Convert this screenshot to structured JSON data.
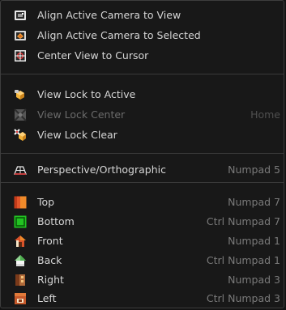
{
  "menu": {
    "items": [
      {
        "label": "Align Active Camera to View",
        "shortcut": "",
        "icon": "camera-view-icon"
      },
      {
        "label": "Align Active Camera to Selected",
        "shortcut": "",
        "icon": "camera-selected-icon"
      },
      {
        "label": "Center View to Cursor",
        "shortcut": "",
        "icon": "cursor-center-icon"
      },
      {
        "label": "View Lock to Active",
        "shortcut": "",
        "icon": "lock-active-icon"
      },
      {
        "label": "View Lock Center",
        "shortcut": "Home",
        "icon": "lock-center-icon",
        "disabled": true
      },
      {
        "label": "View Lock Clear",
        "shortcut": "",
        "icon": "lock-clear-icon"
      },
      {
        "label": "Perspective/Orthographic",
        "shortcut": "Numpad 5",
        "icon": "perspective-icon"
      },
      {
        "label": "Top",
        "shortcut": "Numpad 7",
        "icon": "view-top-icon"
      },
      {
        "label": "Bottom",
        "shortcut": "Ctrl Numpad 7",
        "icon": "view-bottom-icon"
      },
      {
        "label": "Front",
        "shortcut": "Numpad 1",
        "icon": "view-front-icon"
      },
      {
        "label": "Back",
        "shortcut": "Ctrl Numpad 1",
        "icon": "view-back-icon"
      },
      {
        "label": "Right",
        "shortcut": "Numpad 3",
        "icon": "view-right-icon"
      },
      {
        "label": "Left",
        "shortcut": "Ctrl Numpad 3",
        "icon": "view-left-icon"
      }
    ]
  },
  "colors": {
    "background": "#181818",
    "text": "#d6d6d6",
    "disabled_text": "#6b6b6b",
    "shortcut_text": "#7a7a7a"
  }
}
